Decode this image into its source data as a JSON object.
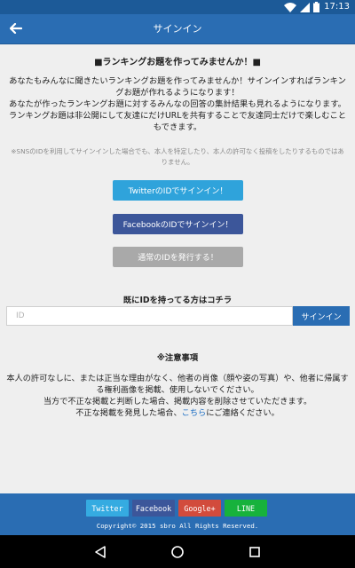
{
  "status_bar": {
    "time": "17:13",
    "icons": [
      "wifi-icon",
      "signal-icon",
      "battery-icon"
    ]
  },
  "app_bar": {
    "title": "サインイン",
    "back_icon": "back-arrow-icon"
  },
  "main": {
    "headline": "■ランキングお題を作ってみませんか！■",
    "intro": [
      "あなたもみんなに聞きたいランキングお題を作ってみませんか！サインインすればランキングお題が作れるようになります！",
      "あなたが作ったランキングお題に対するみんなの回答の集計結果も見れるようになります。",
      "ランキングお題は非公開にして友達にだけURLを共有することで友達同士だけで楽しむこともできます。"
    ],
    "note": "※SNSのIDを利用してサインインした場合でも、本人を特定したり、本人の許可なく投稿をしたりするものではありません。",
    "twitter_button": "TwitterのIDでサインイン！",
    "facebook_button": "FacebookのIDでサインイン！",
    "issue_id_button": "通常のIDを発行する！",
    "existing_label": "既にIDを持ってる方はコチラ",
    "id_input": {
      "placeholder": "ID",
      "value": ""
    },
    "signin_button": "サインイン",
    "caution": {
      "title": "※注意事項",
      "lines": [
        "本人の許可なしに、または正当な理由がなく、他者の肖像（顔や姿の写真）や、他者に帰属する権利画像を掲載、使用しないでください。",
        "当方で不正な掲載と判断した場合、掲載内容を削除させていただきます。"
      ],
      "contact_prefix": "不正な掲載を発見した場合、",
      "contact_link": "こちら",
      "contact_suffix": "にご連絡ください。"
    }
  },
  "footer": {
    "share": {
      "twitter": "Twitter",
      "facebook": "Facebook",
      "google": "Google+",
      "line": "LINE"
    },
    "copyright": "Copyright© 2015 sbro All Rights Reserved."
  },
  "nav_bar": {
    "icons": [
      "back-triangle-icon",
      "home-circle-icon",
      "recents-square-icon"
    ]
  },
  "colors": {
    "primary": "#2a6db3",
    "status_bar": "#1c5a98",
    "twitter": "#2fa3db",
    "facebook": "#3c569a",
    "issue_id": "#a9a9a9",
    "google": "#d24b3c",
    "line": "#17b23c",
    "link": "#1d6fc4"
  }
}
